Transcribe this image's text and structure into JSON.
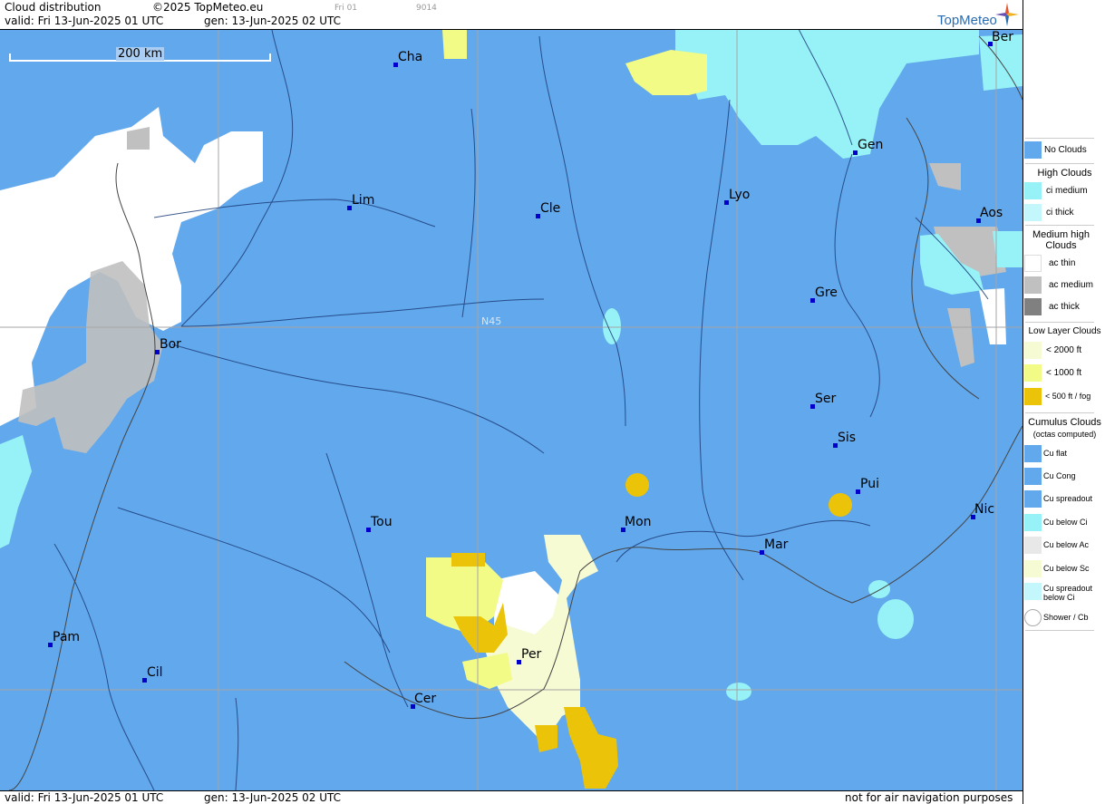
{
  "header": {
    "title": "Cloud distribution",
    "copyright": "©2025 TopMeteo.eu",
    "tiny_run": "Fri 01",
    "tiny_code": "9014",
    "valid": "valid:  Fri  13-Jun-2025  01 UTC",
    "gen": "gen: 13-Jun-2025 02 UTC",
    "brand": "TopMeteo"
  },
  "map": {
    "scale_label": "200 km",
    "grid_label": "N45",
    "water_color": "#62a8ec",
    "cities": [
      {
        "id": "cha",
        "label": "Cha"
      },
      {
        "id": "ber",
        "label": "Ber"
      },
      {
        "id": "lim",
        "label": "Lim"
      },
      {
        "id": "cle",
        "label": "Cle"
      },
      {
        "id": "lyo",
        "label": "Lyo"
      },
      {
        "id": "gen",
        "label": "Gen"
      },
      {
        "id": "aos",
        "label": "Aos"
      },
      {
        "id": "gre",
        "label": "Gre"
      },
      {
        "id": "bor",
        "label": "Bor"
      },
      {
        "id": "ser",
        "label": "Ser"
      },
      {
        "id": "sis",
        "label": "Sis"
      },
      {
        "id": "pui",
        "label": "Pui"
      },
      {
        "id": "nic",
        "label": "Nic"
      },
      {
        "id": "tou",
        "label": "Tou"
      },
      {
        "id": "mon",
        "label": "Mon"
      },
      {
        "id": "mar",
        "label": "Mar"
      },
      {
        "id": "pam",
        "label": "Pam"
      },
      {
        "id": "cil",
        "label": "Cil"
      },
      {
        "id": "per",
        "label": "Per"
      },
      {
        "id": "cer",
        "label": "Cer"
      }
    ]
  },
  "footer": {
    "valid": "valid:  Fri  13-Jun-2025  01 UTC",
    "gen": "gen: 13-Jun-2025 02 UTC",
    "disclaimer": "not for air navigation purposes"
  },
  "legend": {
    "no_clouds": "No Clouds",
    "high_title": "High Clouds",
    "ci_medium": "ci medium",
    "ci_thick": "ci thick",
    "medium_title": "Medium high Clouds",
    "ac_thin": "ac thin",
    "ac_medium": "ac medium",
    "ac_thick": "ac thick",
    "low_title": "Low Layer Clouds",
    "low_2000": "< 2000 ft",
    "low_1000": "< 1000 ft",
    "low_500": "< 500 ft / fog",
    "cu_title": "Cumulus Clouds",
    "cu_sub": "(octas computed)",
    "cu_flat": "Cu flat",
    "cu_cong": "Cu Cong",
    "cu_spreadout": "Cu spreadout",
    "cu_below_ci": "Cu below Ci",
    "cu_below_ac": "Cu below Ac",
    "cu_below_sc": "Cu below Sc",
    "cu_spreadout_below_ci": "Cu spreadout below Ci",
    "shower_cb": "Shower / Cb",
    "colors": {
      "no_clouds": "#62a8ec",
      "ci_medium": "#96f2f6",
      "ci_thick": "#c4f7fb",
      "ac_thin": "#ffffff",
      "ac_medium": "#c0c0c0",
      "ac_thick": "#808080",
      "low_2000": "#f7fbd4",
      "low_1000": "#f2fb86",
      "low_500": "#ebc309"
    }
  }
}
